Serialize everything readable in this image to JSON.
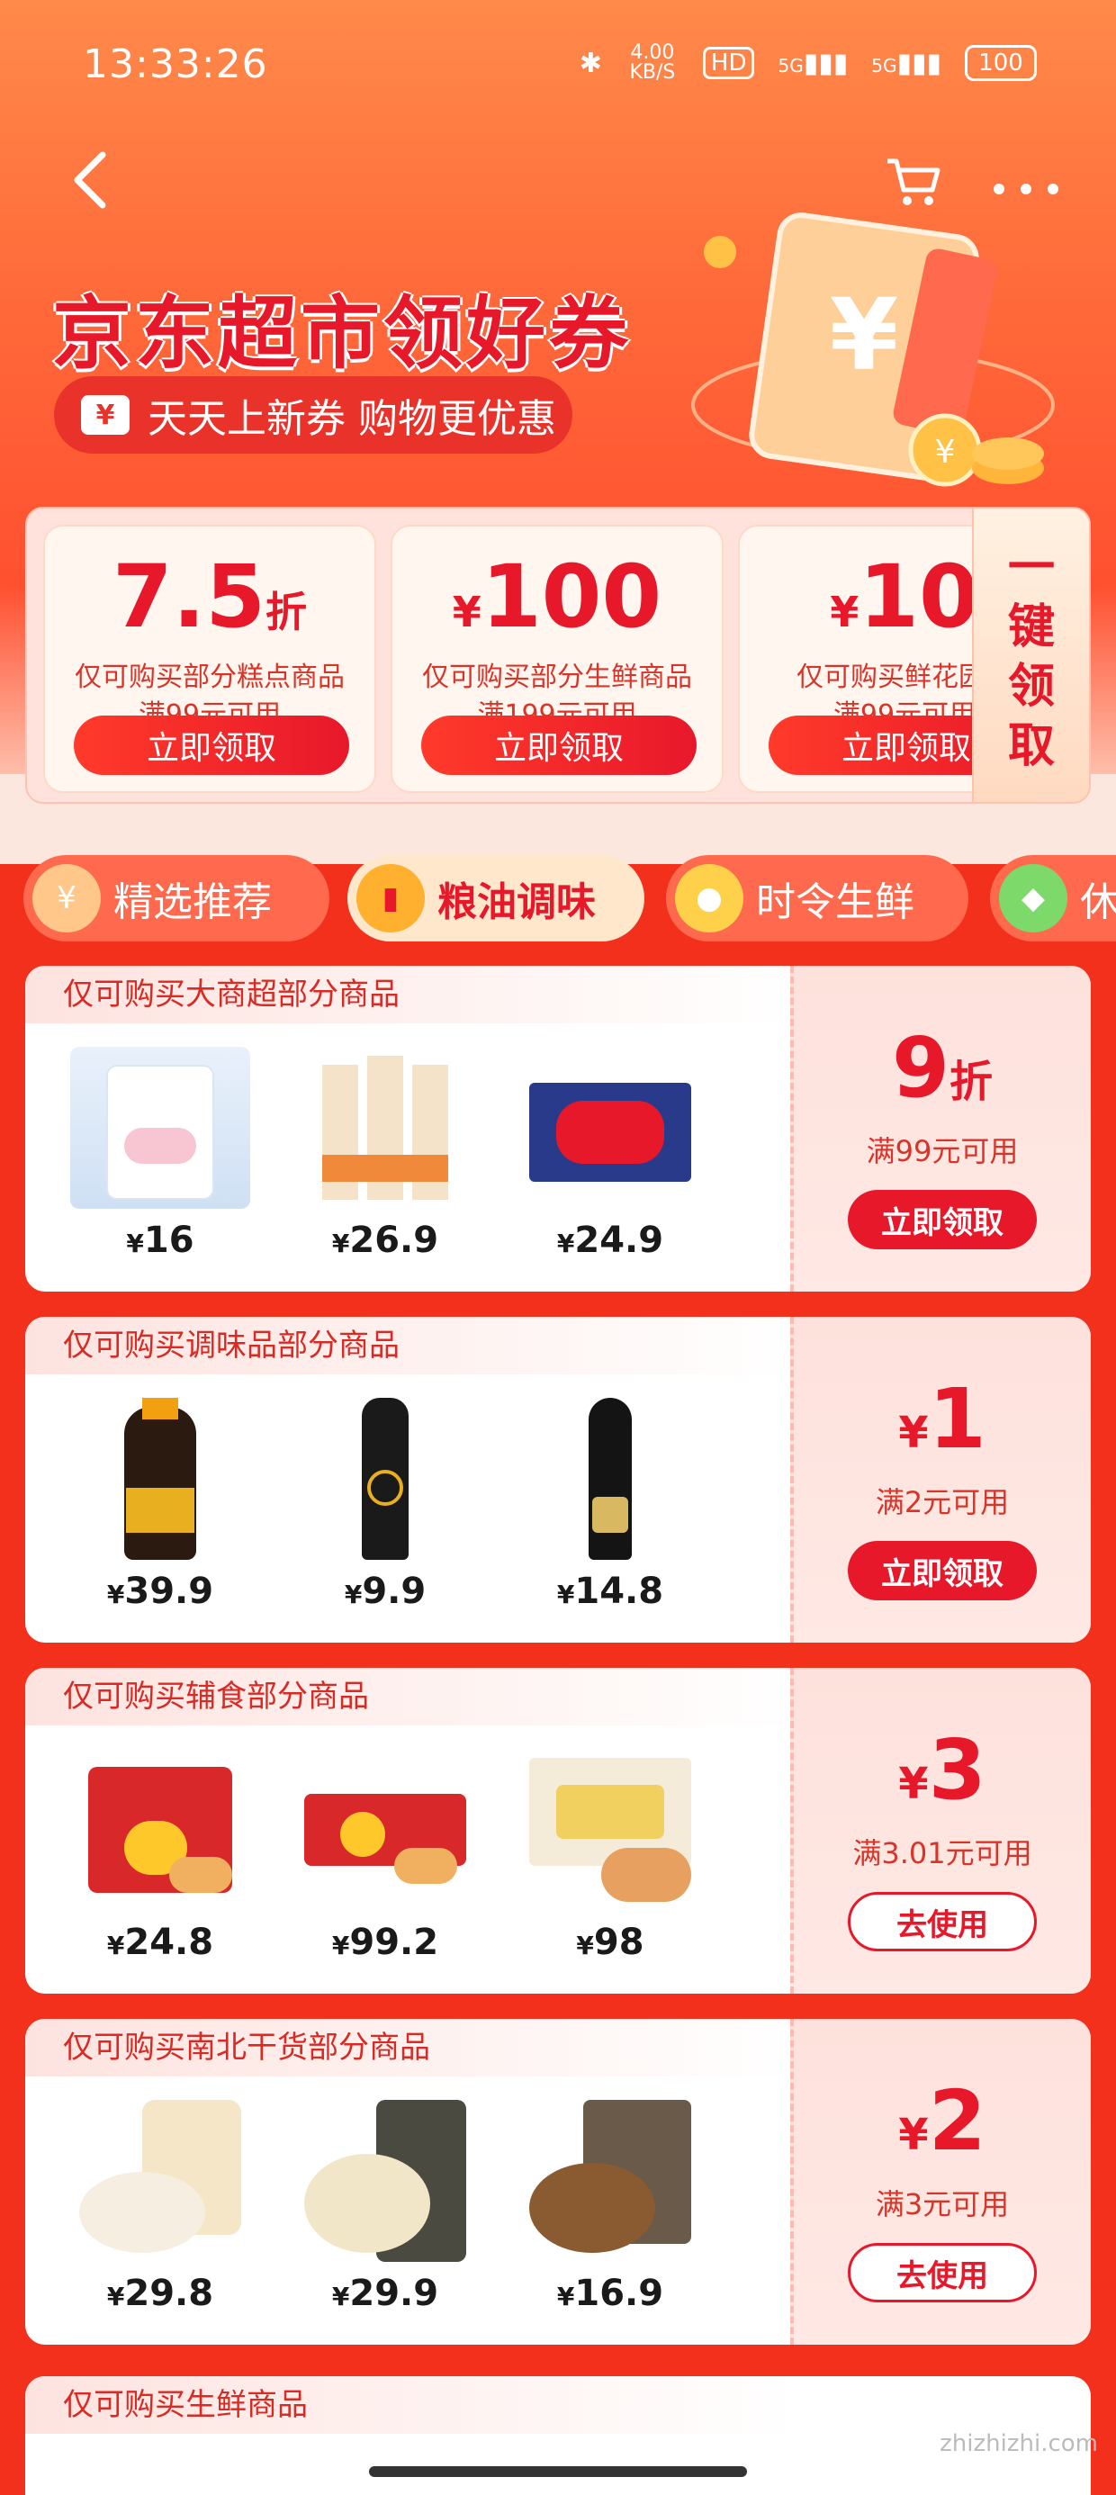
{
  "status_bar": {
    "time": "13:33:26",
    "speed": "4.00 KB/S",
    "hd": "HD",
    "net1": "5G",
    "net2": "5G",
    "battery": "100"
  },
  "header": {
    "title": "京东超市领好券",
    "subtitle": "天天上新券 购物更优惠",
    "yen": "¥"
  },
  "top_coupons": [
    {
      "value": "7.5",
      "unit": "折",
      "desc": "仅可购买部分糕点商品",
      "cond": "满99元可用",
      "button": "立即领取"
    },
    {
      "value": "100",
      "unit": "¥",
      "desc": "仅可购买部分生鲜商品",
      "cond": "满199元可用",
      "button": "立即领取"
    },
    {
      "value": "10",
      "unit": "¥",
      "desc": "仅可购买鲜花园艺",
      "cond": "满99元可用",
      "button": "立即领取"
    }
  ],
  "one_key": [
    "一",
    "键",
    "领",
    "取"
  ],
  "tabs": [
    "精选推荐",
    "粮油调味",
    "时令生鲜",
    "休"
  ],
  "rows": [
    {
      "head": "仅可购买大商超部分商品",
      "value": "9",
      "unit": "折",
      "cond": "满99元可用",
      "button": "立即领取",
      "btn_style": "solid",
      "prices": [
        "16",
        "26.9",
        "24.9"
      ]
    },
    {
      "head": "仅可购买调味品部分商品",
      "value": "1",
      "unit": "¥",
      "cond": "满2元可用",
      "button": "立即领取",
      "btn_style": "solid",
      "prices": [
        "39.9",
        "9.9",
        "14.8"
      ]
    },
    {
      "head": "仅可购买辅食部分商品",
      "value": "3",
      "unit": "¥",
      "cond": "满3.01元可用",
      "button": "去使用",
      "btn_style": "outline",
      "prices": [
        "24.8",
        "99.2",
        "98"
      ]
    },
    {
      "head": "仅可购买南北干货部分商品",
      "value": "2",
      "unit": "¥",
      "cond": "满3元可用",
      "button": "去使用",
      "btn_style": "outline",
      "prices": [
        "29.8",
        "29.9",
        "16.9"
      ]
    }
  ],
  "last_row_head": "仅可购买生鲜商品",
  "watermark": "zhizhizhi.com",
  "colors": {
    "brand_red": "#e8182b",
    "bg_red": "#f2301c"
  }
}
